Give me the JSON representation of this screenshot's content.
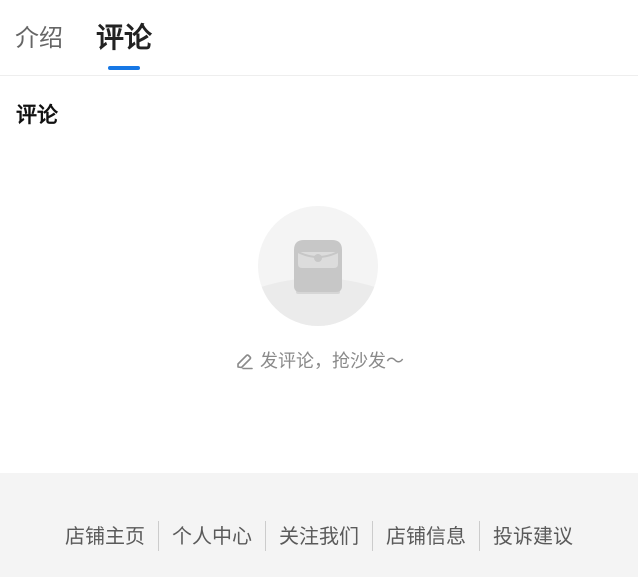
{
  "tabs": [
    {
      "label": "介绍",
      "active": false
    },
    {
      "label": "评论",
      "active": true
    }
  ],
  "accent_color": "#1677e5",
  "section_title": "评论",
  "empty_state": {
    "icon": "empty-box-icon",
    "action_icon": "pencil-icon",
    "action_text": "发评论，抢沙发～"
  },
  "footer": {
    "links": [
      "店铺主页",
      "个人中心",
      "关注我们",
      "店铺信息",
      "投诉建议"
    ]
  }
}
